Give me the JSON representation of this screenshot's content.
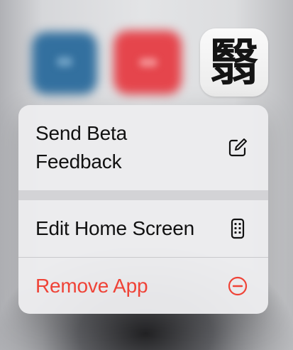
{
  "app": {
    "icon_glyph": "翳",
    "icon_name": "mahjong-app-icon"
  },
  "background_icons": [
    {
      "name": "blurred-blue-app-icon",
      "color": "#33709f"
    },
    {
      "name": "blurred-red-app-icon",
      "color": "#e5454c"
    }
  ],
  "context_menu": {
    "items": [
      {
        "label": "Send Beta Feedback",
        "icon": "compose-icon"
      },
      {
        "label": "Edit Home Screen",
        "icon": "phone-icon"
      },
      {
        "label": "Remove App",
        "icon": "minus-circle-icon",
        "color": "#ef4337",
        "destructive": true
      }
    ]
  }
}
